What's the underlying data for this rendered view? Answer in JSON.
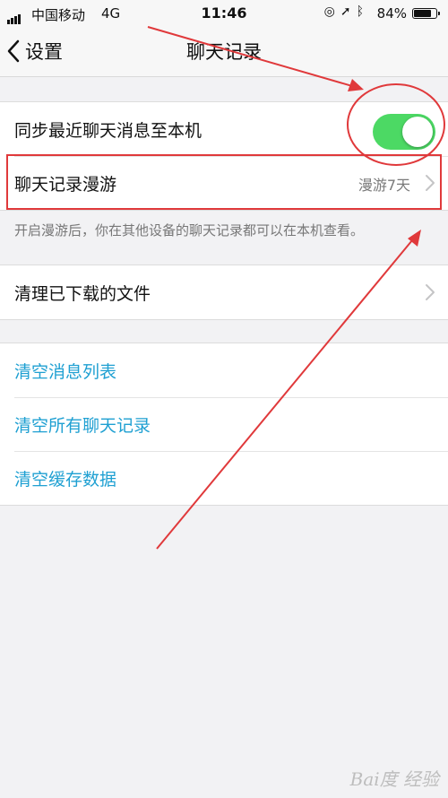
{
  "status_bar": {
    "carrier": "中国移动",
    "network": "4G",
    "time": "11:46",
    "battery_percent_text": "84%",
    "battery_level": 0.84
  },
  "nav": {
    "back_label": "设置",
    "title": "聊天记录"
  },
  "settings": {
    "sync": {
      "label": "同步最近聊天消息至本机",
      "enabled": true
    },
    "roaming": {
      "label": "聊天记录漫游",
      "value": "漫游7天"
    },
    "roaming_hint": "开启漫游后，你在其他设备的聊天记录都可以在本机查看。",
    "clear_downloads": {
      "label": "清理已下载的文件"
    }
  },
  "actions": [
    {
      "label": "清空消息列表"
    },
    {
      "label": "清空所有聊天记录"
    },
    {
      "label": "清空缓存数据"
    }
  ],
  "accent_colors": {
    "toggle_on": "#4cd964",
    "link": "#1fa0d2",
    "annotation": "#e0393b"
  },
  "watermark": "Bai度 经验"
}
